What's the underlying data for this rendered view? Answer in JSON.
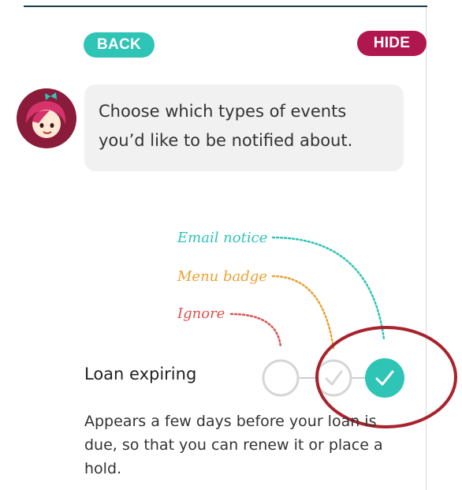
{
  "header": {
    "back_label": "BACK",
    "hide_label": "HIDE"
  },
  "assistant": {
    "message": "Choose which types of events you’d like to be notified about."
  },
  "legend": {
    "email": "Email notice",
    "badge": "Menu badge",
    "ignore": "Ignore"
  },
  "setting": {
    "title": "Loan expiring",
    "description": "Appears a few days before your loan is due, so that you can renew it or place a hold.",
    "selected_option": "Email notice"
  },
  "colors": {
    "teal": "#2ec4b6",
    "crimson": "#b0174e",
    "orange": "#eaa232",
    "red": "#d9534f",
    "annotation": "#a8232c"
  }
}
